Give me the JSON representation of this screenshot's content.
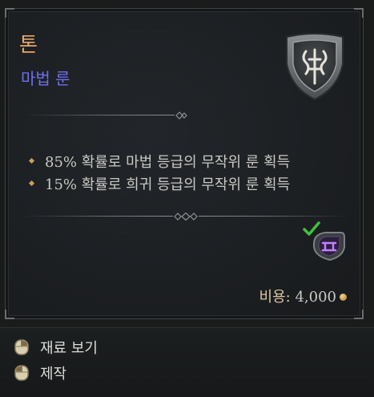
{
  "tooltip": {
    "name": "톤",
    "type": "마법 룬",
    "effects": [
      "85% 확률로 마법 등급의 무작위 룬 획득",
      "15% 확률로 희귀 등급의 무작위 룬 획득"
    ],
    "cost_label": "비용:",
    "cost_value": "4,000",
    "emblem_icon": "rune-shield-emblem",
    "slot_icon": "magic-rune-check-icon"
  },
  "actions": [
    {
      "label": "재료 보기",
      "icon": "mouse-right-click-icon"
    },
    {
      "label": "제작",
      "icon": "mouse-left-click-icon"
    }
  ],
  "colors": {
    "name": "#e8a86a",
    "type": "#6f6ff0",
    "check": "#3ec23e",
    "rune": "#b06cf0"
  }
}
